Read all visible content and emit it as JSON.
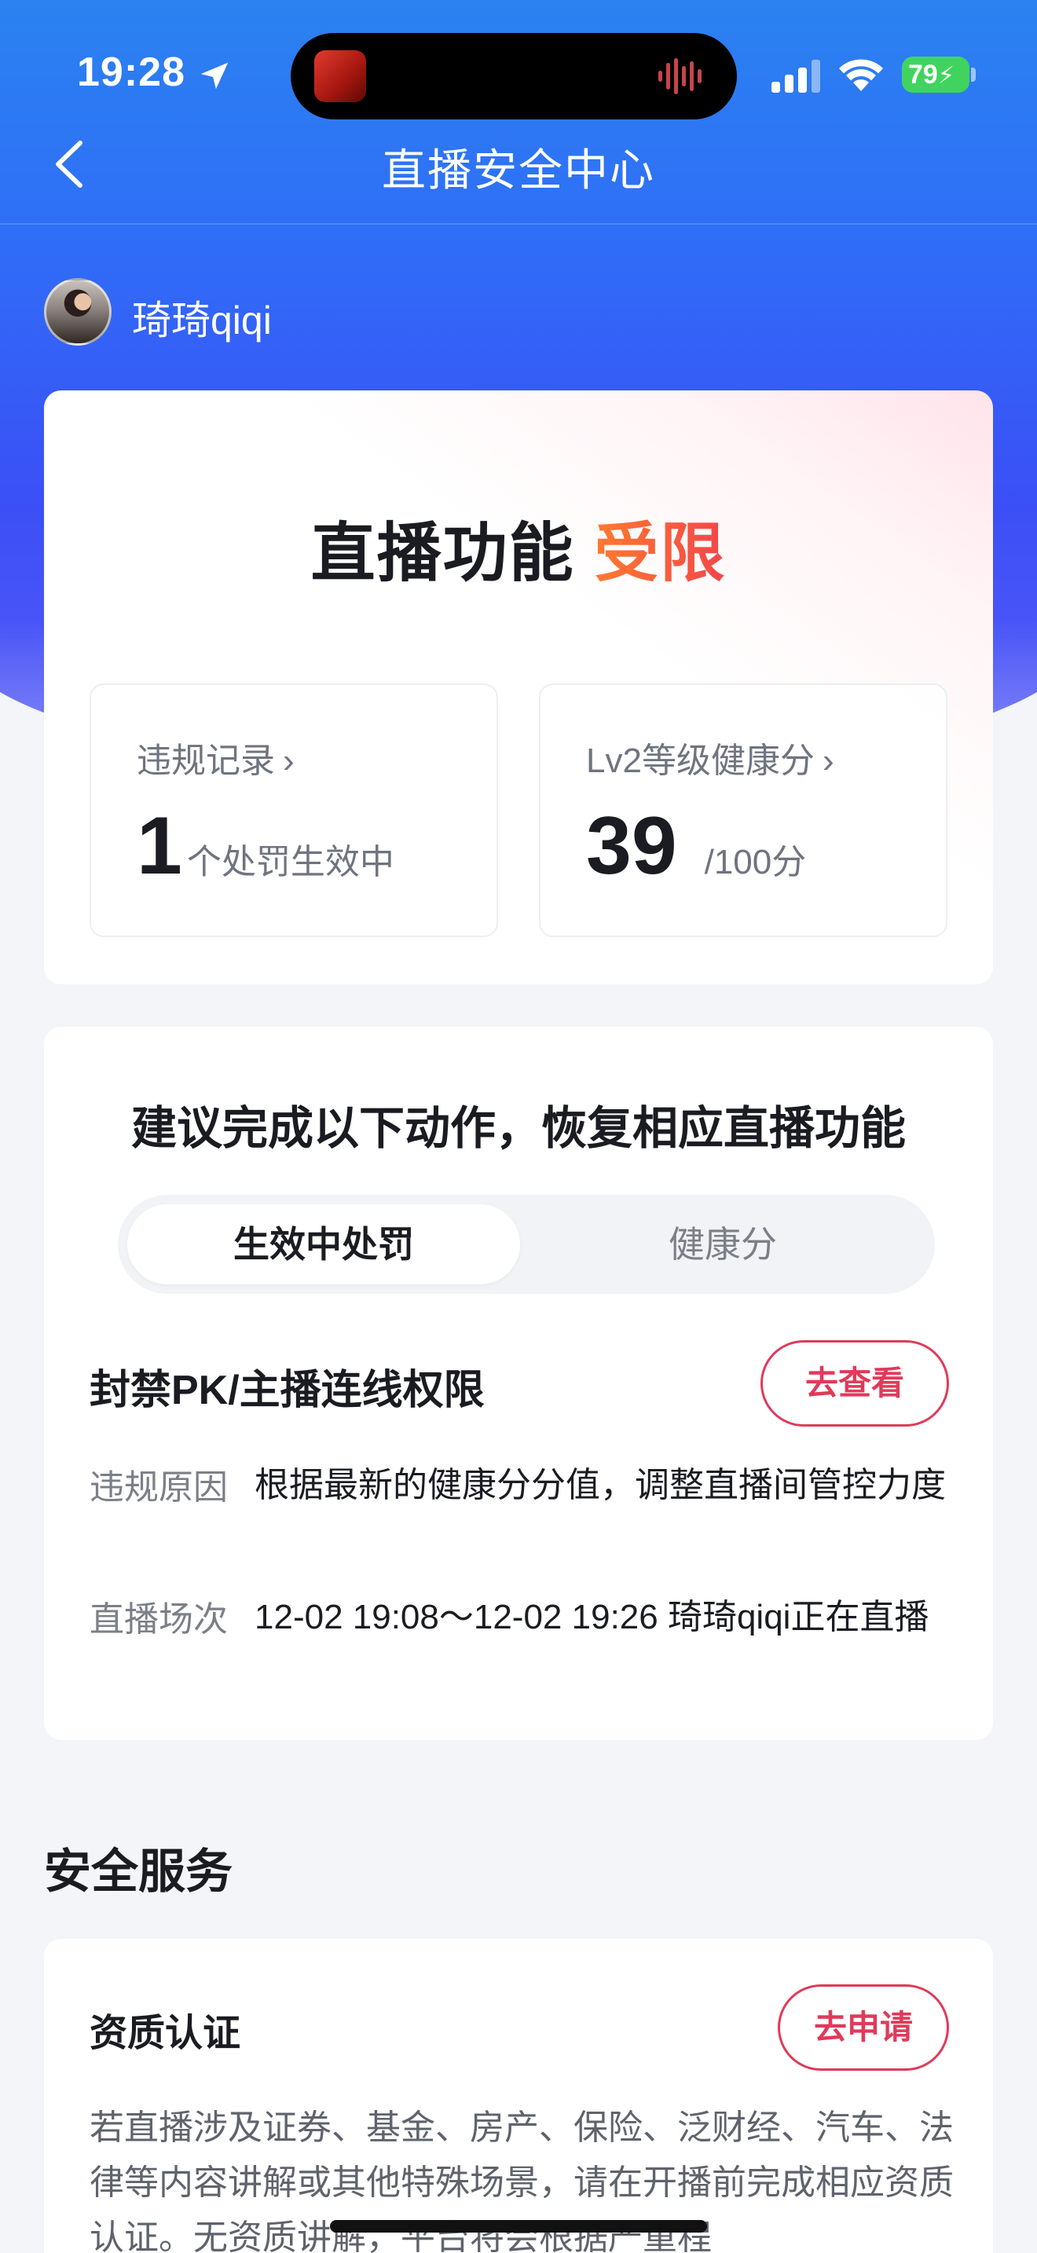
{
  "status_bar": {
    "time": "19:28",
    "battery": "79"
  },
  "nav": {
    "title": "直播安全中心"
  },
  "user": {
    "name": "琦琦qiqi"
  },
  "status": {
    "prefix": "直播功能",
    "highlight": "受限",
    "highlight_color": "#f2464a"
  },
  "stats": {
    "violations": {
      "label": "违规记录",
      "value": "1",
      "unit": "个处罚生效中"
    },
    "health": {
      "label": "Lv2等级健康分",
      "value": "39",
      "unit": "/100分"
    }
  },
  "recommend": {
    "title": "建议完成以下动作，恢复相应直播功能",
    "tabs": [
      "生效中处罚",
      "健康分"
    ],
    "active_tab": 0,
    "item": {
      "title": "封禁PK/主播连线权限",
      "button": "去查看",
      "reason_label": "违规原因",
      "reason_value": "根据最新的健康分分值，调整直播间管控力度",
      "session_label": "直播场次",
      "session_value": "12-02 19:08～12-02 19:26 琦琦qiqi正在直播"
    }
  },
  "services": {
    "section_title": "安全服务",
    "card": {
      "title": "资质认证",
      "button": "去申请",
      "desc": "若直播涉及证券、基金、房产、保险、泛财经、汽车、法律等内容讲解或其他特殊场景，请在开播前完成相应资质认证。无资质讲解，平台将会根据严重程"
    }
  },
  "colors": {
    "accent": "#e03a5a",
    "header_blue": "#2f6ef7"
  }
}
